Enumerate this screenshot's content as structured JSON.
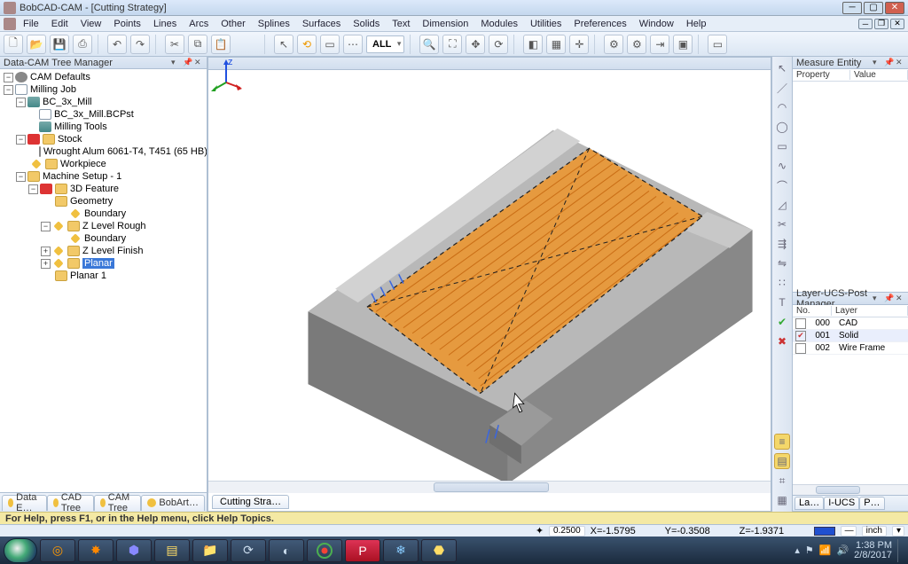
{
  "title": "BobCAD-CAM - [Cutting Strategy]",
  "menu": [
    "File",
    "Edit",
    "View",
    "Points",
    "Lines",
    "Arcs",
    "Other",
    "Splines",
    "Surfaces",
    "Solids",
    "Text",
    "Dimension",
    "Modules",
    "Utilities",
    "Preferences",
    "Window",
    "Help"
  ],
  "all_label": "ALL",
  "left_panel_title": "Data-CAM Tree Manager",
  "tree": {
    "n0": "CAM Defaults",
    "n1": "Milling Job",
    "n2": "BC_3x_Mill",
    "n3": "BC_3x_Mill.BCPst",
    "n4": "Milling Tools",
    "n5": "Stock",
    "n6": "Wrought Alum 6061-T4, T451 (65 HB)",
    "n7": "Workpiece",
    "n8": "Machine Setup - 1",
    "n9": "3D Feature",
    "n10": "Geometry",
    "n11": "Boundary",
    "n12": "Z Level Rough",
    "n13": "Boundary",
    "n14": "Z Level Finish",
    "n15": "Planar",
    "n16": "Planar 1"
  },
  "left_tabs": [
    "Data E…",
    "CAD Tree",
    "CAM Tree",
    "BobArt…"
  ],
  "view_tab": "Cutting Stra…",
  "measure": {
    "title": "Measure Entity",
    "col1": "Property",
    "col2": "Value"
  },
  "layers": {
    "title": "Layer-UCS-Post Manager",
    "col_no": "No.",
    "col_layer": "Layer",
    "rows": [
      {
        "no": "000",
        "name": "CAD",
        "checked": false
      },
      {
        "no": "001",
        "name": "Solid",
        "checked": true
      },
      {
        "no": "002",
        "name": "Wire Frame",
        "checked": false
      }
    ],
    "tabs": [
      "La…",
      "I-UCS",
      "P…"
    ]
  },
  "help_hint": "For Help, press F1, or in the Help menu, click Help Topics.",
  "status": {
    "inc": "0.2500",
    "x": "X=-1.5795",
    "y": "Y=-0.3508",
    "z": "Z=-1.9371",
    "unit": "inch"
  },
  "tray": {
    "time": "1:38 PM",
    "date": "2/8/2017"
  }
}
